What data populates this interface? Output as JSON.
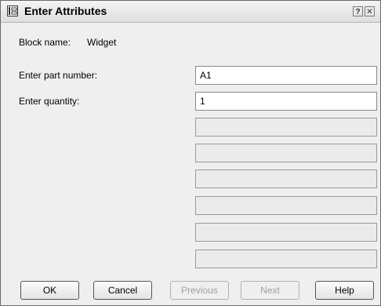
{
  "window": {
    "title": "Enter Attributes",
    "help_glyph": "?",
    "close_glyph": "✕"
  },
  "block": {
    "label": "Block name:",
    "value": "Widget"
  },
  "fields": [
    {
      "label": "Enter part number:",
      "value": "A1"
    },
    {
      "label": "Enter quantity:",
      "value": "1"
    }
  ],
  "buttons": {
    "ok": "OK",
    "cancel": "Cancel",
    "previous": "Previous",
    "next": "Next",
    "help": "Help"
  },
  "colors": {
    "dialog_background": "#efefef",
    "disabled_field": "#ebebeb",
    "disabled_text": "#a0a0a0"
  }
}
